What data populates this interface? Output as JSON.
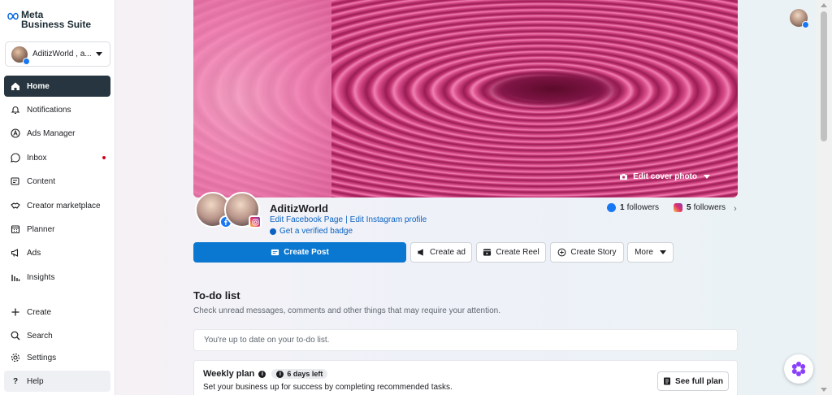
{
  "brand": {
    "line1": "Meta",
    "line2": "Business Suite"
  },
  "account": {
    "name": "AditizWorld , a..."
  },
  "nav": [
    {
      "label": "Home",
      "icon": "home-icon"
    },
    {
      "label": "Notifications",
      "icon": "bell-icon"
    },
    {
      "label": "Ads Manager",
      "icon": "ads-manager-icon"
    },
    {
      "label": "Inbox",
      "icon": "chat-icon"
    },
    {
      "label": "Content",
      "icon": "content-icon"
    },
    {
      "label": "Creator marketplace",
      "icon": "handshake-icon"
    },
    {
      "label": "Planner",
      "icon": "calendar-icon"
    },
    {
      "label": "Ads",
      "icon": "megaphone-icon"
    },
    {
      "label": "Insights",
      "icon": "bar-chart-icon"
    }
  ],
  "bottom_nav": [
    {
      "label": "Create",
      "icon": "plus-icon"
    },
    {
      "label": "Search",
      "icon": "search-icon"
    },
    {
      "label": "Settings",
      "icon": "gear-icon"
    },
    {
      "label": "Help",
      "icon": "question-icon"
    }
  ],
  "cover": {
    "edit_label": "Edit cover photo"
  },
  "profile": {
    "name": "AditizWorld",
    "edit_fb": "Edit Facebook Page",
    "edit_ig": "Edit Instagram profile",
    "separator": "|",
    "verified": "Get a verified badge",
    "fb_followers": "1",
    "ig_followers": "5",
    "followers_label": "followers"
  },
  "actions": {
    "create_post": "Create Post",
    "create_ad": "Create ad",
    "create_reel": "Create Reel",
    "create_story": "Create Story",
    "more": "More"
  },
  "todo": {
    "title": "To-do list",
    "subtitle": "Check unread messages, comments and other things that may require your attention.",
    "up_to_date": "You're up to date on your to-do list."
  },
  "weekly": {
    "title": "Weekly plan",
    "days_left": "6 days left",
    "subtitle": "Set your business up for success by completing recommended tasks.",
    "full_plan": "See full plan"
  },
  "colors": {
    "accent": "#0a78d1",
    "nav_active": "#263540",
    "link": "#0a62c2",
    "facebook": "#1877f2"
  }
}
